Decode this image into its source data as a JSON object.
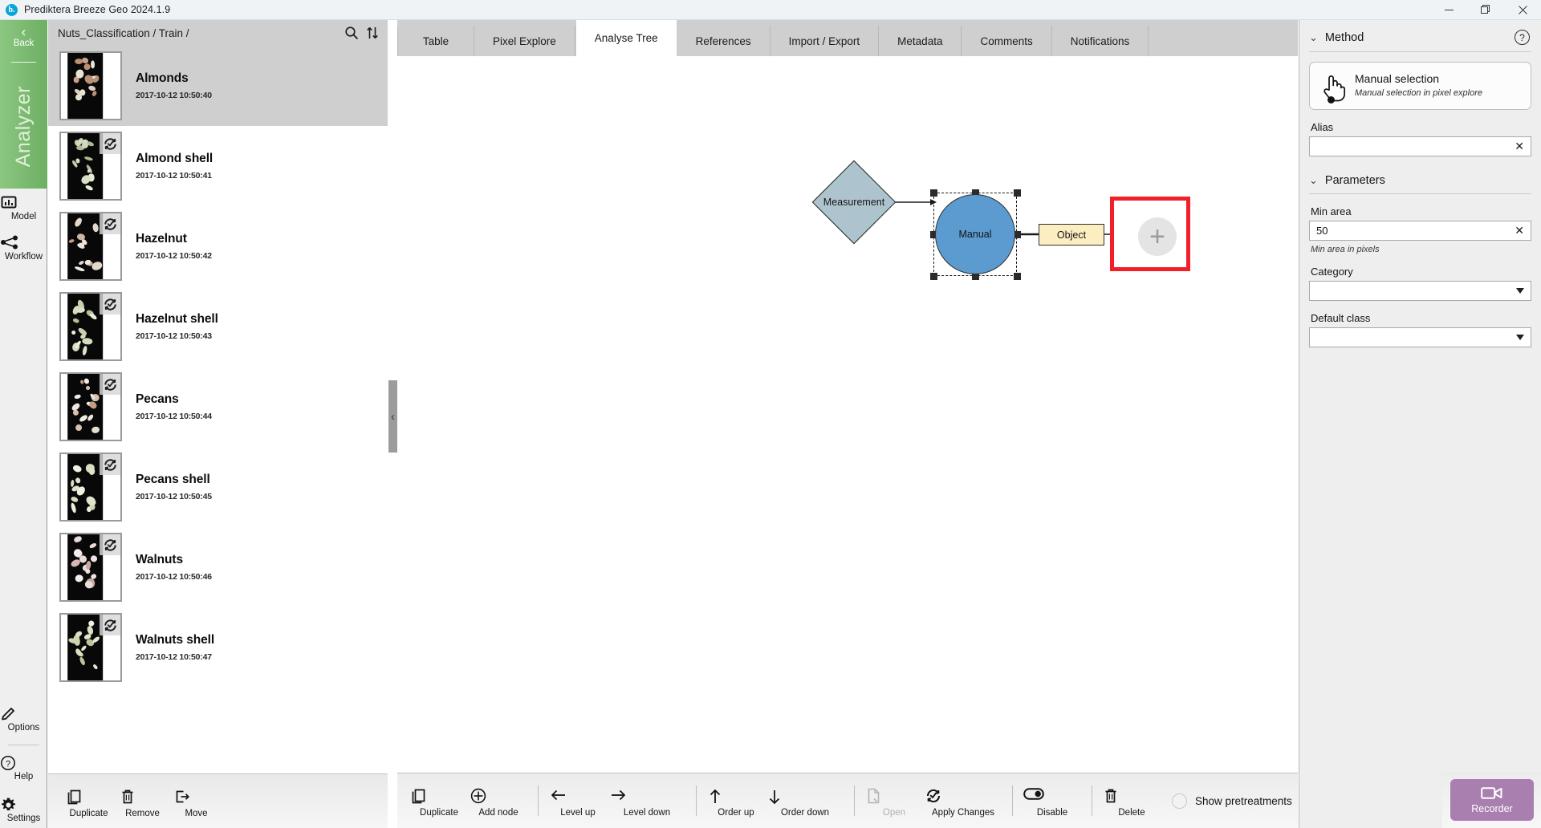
{
  "window": {
    "title": "Prediktera Breeze Geo 2024.1.9",
    "logo_letter": "b.",
    "minimize": "—",
    "restore": "❐",
    "close": "✕"
  },
  "rail": {
    "back_label": "Back",
    "back_chevron": "‹",
    "module_name": "Analyzer",
    "items": [
      {
        "label": "Model",
        "icon": "model-icon"
      },
      {
        "label": "Workflow",
        "icon": "workflow-icon"
      }
    ],
    "bottom_items": [
      {
        "label": "Options",
        "icon": "pencil-icon"
      },
      {
        "label": "Help",
        "icon": "question-icon"
      },
      {
        "label": "Settings",
        "icon": "gear-icon"
      }
    ]
  },
  "left_panel": {
    "breadcrumb": "Nuts_Classification / Train /",
    "search_icon": "search-icon",
    "sort_icon": "sort-updown-icon",
    "items": [
      {
        "title": "Almonds",
        "date": "2017-10-12 10:50:40",
        "selected": true,
        "has_badge": false
      },
      {
        "title": "Almond shell",
        "date": "2017-10-12 10:50:41",
        "selected": false,
        "has_badge": true
      },
      {
        "title": "Hazelnut",
        "date": "2017-10-12 10:50:42",
        "selected": false,
        "has_badge": true
      },
      {
        "title": "Hazelnut shell",
        "date": "2017-10-12 10:50:43",
        "selected": false,
        "has_badge": true
      },
      {
        "title": "Pecans",
        "date": "2017-10-12 10:50:44",
        "selected": false,
        "has_badge": true
      },
      {
        "title": "Pecans shell",
        "date": "2017-10-12 10:50:45",
        "selected": false,
        "has_badge": true
      },
      {
        "title": "Walnuts",
        "date": "2017-10-12 10:50:46",
        "selected": false,
        "has_badge": true
      },
      {
        "title": "Walnuts shell",
        "date": "2017-10-12 10:50:47",
        "selected": false,
        "has_badge": true
      }
    ],
    "toolbar": [
      {
        "label": "Duplicate",
        "icon": "duplicate-icon",
        "disabled": false
      },
      {
        "label": "Remove",
        "icon": "trash-icon",
        "disabled": false
      },
      {
        "label": "Move",
        "icon": "move-out-icon",
        "disabled": false
      }
    ]
  },
  "center": {
    "tabs": [
      {
        "label": "Table",
        "active": false
      },
      {
        "label": "Pixel Explore",
        "active": false
      },
      {
        "label": "Analyse Tree",
        "active": true
      },
      {
        "label": "References",
        "active": false
      },
      {
        "label": "Import / Export",
        "active": false
      },
      {
        "label": "Metadata",
        "active": false
      },
      {
        "label": "Comments",
        "active": false
      },
      {
        "label": "Notifications",
        "active": false
      }
    ],
    "collapse_left_icon": "chevron-left-icon",
    "collapse_right_icon": "chevron-right-icon",
    "tree": {
      "measurement_label": "Measurement",
      "manual_label": "Manual",
      "object_label": "Object",
      "add_node_glyph": "+",
      "colors": {
        "measurement_fill": "#adc4ce",
        "manual_fill": "#5b9bd0",
        "object_fill": "#fdeec2",
        "highlight_border": "#f01f28",
        "add_circle_fill": "#e4e4e4"
      }
    },
    "toolbar": [
      {
        "label": "Duplicate",
        "icon": "duplicate-icon",
        "disabled": false
      },
      {
        "label": "Add node",
        "icon": "plus-circle-icon",
        "disabled": false
      },
      {
        "sep": true
      },
      {
        "label": "Level up",
        "icon": "arrow-left-icon",
        "disabled": false
      },
      {
        "label": "Level down",
        "icon": "arrow-right-icon",
        "disabled": false
      },
      {
        "sep": true
      },
      {
        "label": "Order up",
        "icon": "arrow-up-icon",
        "disabled": false
      },
      {
        "label": "Order down",
        "icon": "arrow-down-icon",
        "disabled": false
      },
      {
        "sep": true
      },
      {
        "label": "Open",
        "icon": "file-open-icon",
        "disabled": true
      },
      {
        "label": "Apply Changes",
        "icon": "refresh-check-icon",
        "disabled": false
      },
      {
        "sep": true
      },
      {
        "label": "Disable",
        "icon": "toggle-icon",
        "disabled": false
      },
      {
        "sep": true
      },
      {
        "label": "Delete",
        "icon": "trash-icon",
        "disabled": false
      }
    ],
    "show_pretreatments_label": "Show pretreatments",
    "show_pretreatments_checked": false
  },
  "right_panel": {
    "method": {
      "title": "Method",
      "chevron": "⌄",
      "help_glyph": "?",
      "card_icon": "hand-pointer-icon",
      "card_name": "Manual selection",
      "card_sub": "Manual selection in pixel explore",
      "alias_label": "Alias",
      "alias_value": "",
      "alias_placeholder": "",
      "clear_glyph": "✕"
    },
    "parameters": {
      "title": "Parameters",
      "chevron": "⌄",
      "min_area_label": "Min area",
      "min_area_value": "50",
      "min_area_hint": "Min area in pixels",
      "clear_glyph": "✕",
      "category_label": "Category",
      "category_value": "",
      "default_class_label": "Default class",
      "default_class_value": ""
    }
  },
  "recorder": {
    "label": "Recorder",
    "icon": "video-camera-icon"
  }
}
